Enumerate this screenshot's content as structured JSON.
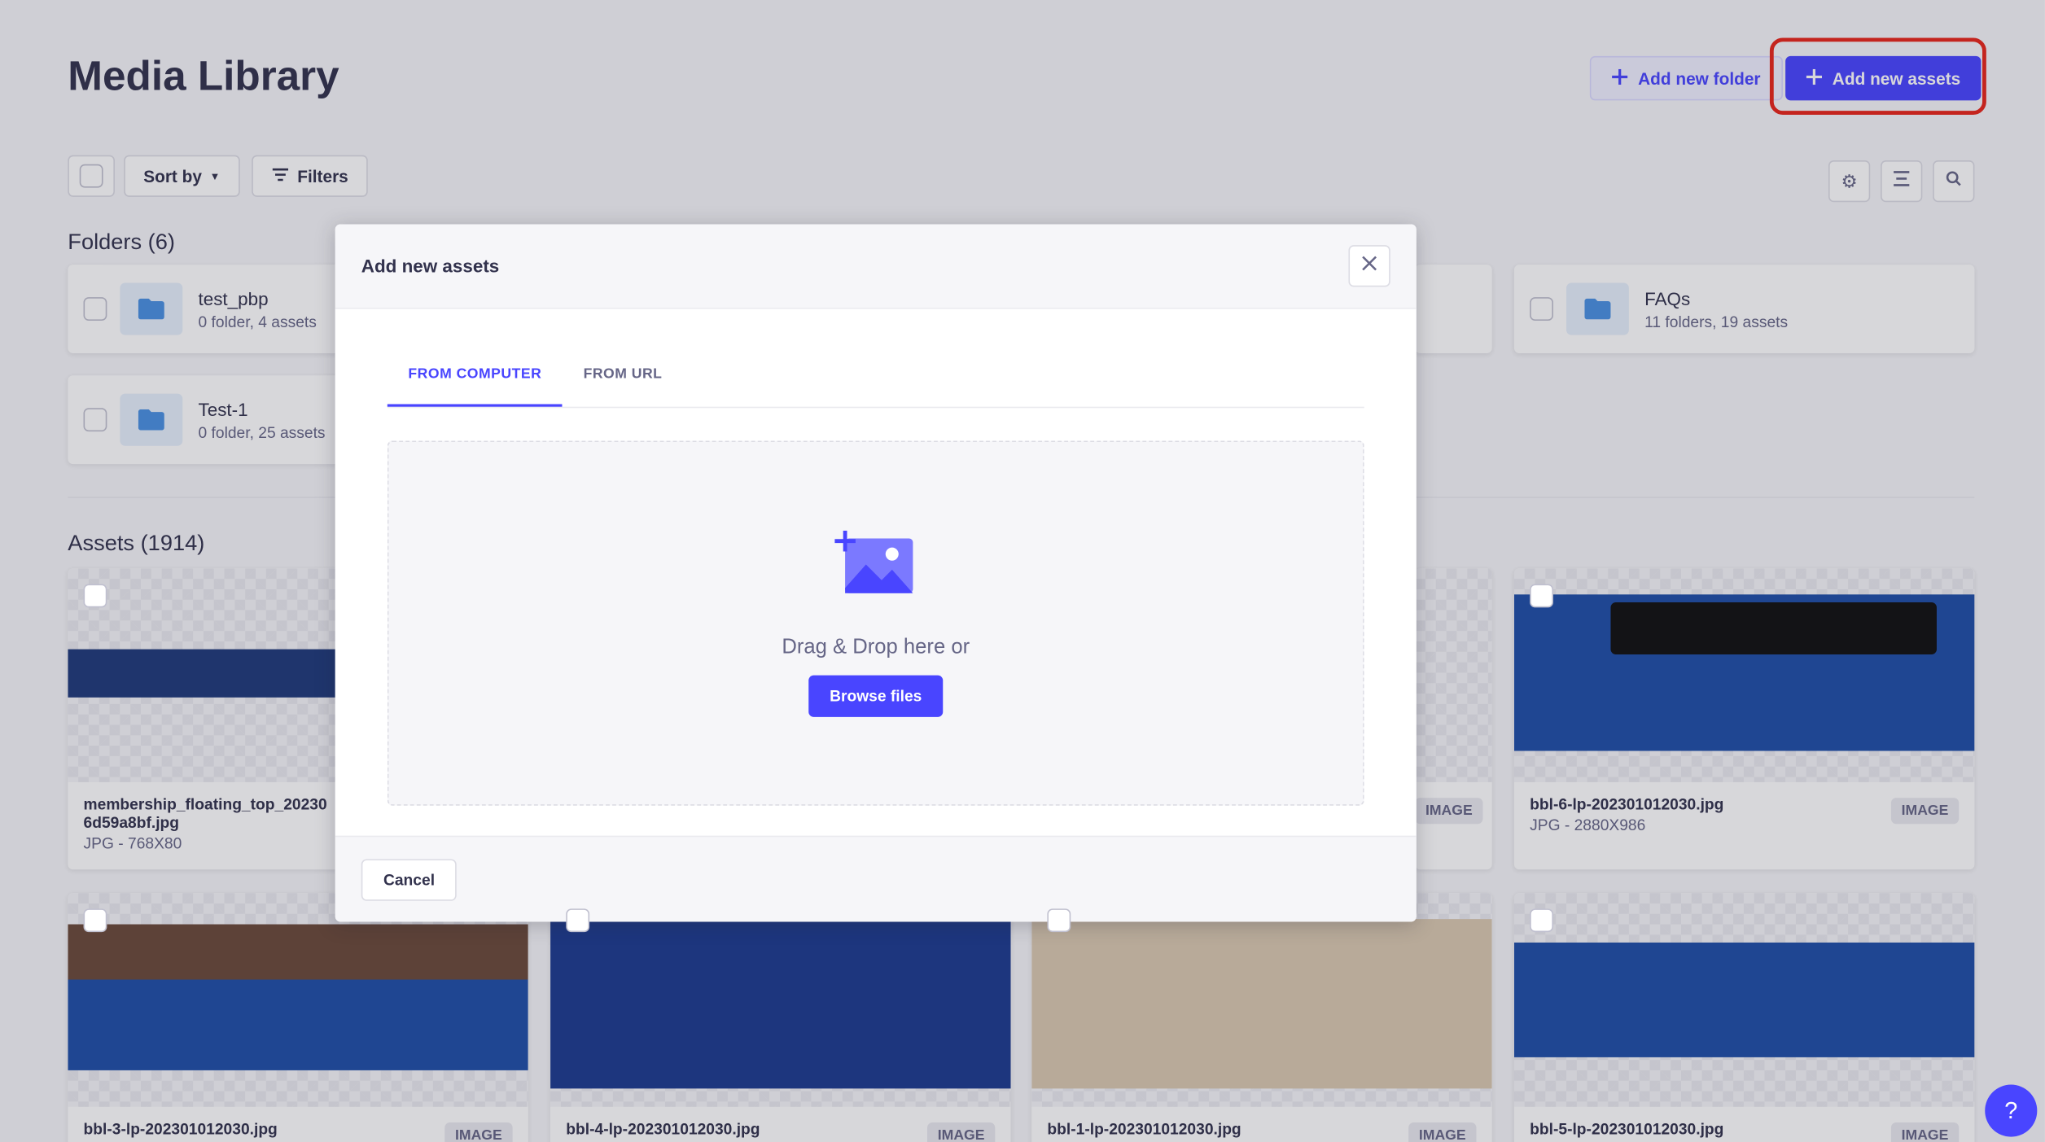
{
  "header": {
    "title": "Media Library",
    "add_folder_label": "Add new folder",
    "add_assets_label": "Add new assets"
  },
  "toolbar": {
    "sort_label": "Sort by",
    "filters_label": "Filters"
  },
  "folders": {
    "heading": "Folders (6)",
    "items": [
      {
        "name": "test_pbp",
        "meta": "0 folder, 4 assets"
      },
      {
        "name": "FAQs",
        "meta": "11 folders, 19 assets"
      },
      {
        "name": "Test-1",
        "meta": "0 folder, 25 assets"
      }
    ]
  },
  "assets": {
    "heading": "Assets (1914)",
    "items": [
      {
        "name": "membership_floating_top_20230",
        "name2": "6d59a8bf.jpg",
        "meta": "JPG - 768X80",
        "badge": ""
      },
      {
        "name": "",
        "meta": "",
        "badge": "IMAGE"
      },
      {
        "name": "bbl-6-lp-202301012030.jpg",
        "meta": "JPG - 2880X986",
        "badge": "IMAGE"
      },
      {
        "name": "bbl-3-lp-202301012030.jpg",
        "meta": "",
        "badge": "IMAGE"
      },
      {
        "name": "bbl-4-lp-202301012030.jpg",
        "meta": "",
        "badge": "IMAGE"
      },
      {
        "name": "bbl-1-lp-202301012030.jpg",
        "meta": "",
        "badge": "IMAGE"
      },
      {
        "name": "bbl-5-lp-202301012030.jpg",
        "meta": "",
        "badge": "IMAGE"
      }
    ]
  },
  "modal": {
    "title": "Add new assets",
    "tabs": [
      "FROM COMPUTER",
      "FROM URL"
    ],
    "dropzone_text": "Drag & Drop here or",
    "browse_label": "Browse files",
    "cancel_label": "Cancel"
  },
  "help": {
    "label": "?"
  },
  "colors": {
    "accent": "#4945ff",
    "highlight": "#e8251a"
  }
}
